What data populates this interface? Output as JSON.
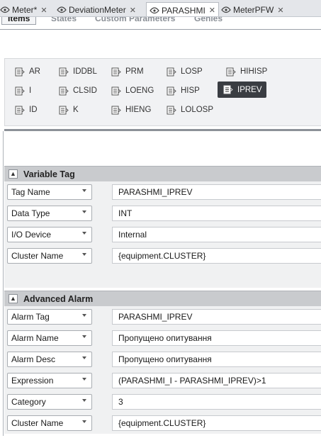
{
  "doc_tabs": [
    {
      "label": "Meter*"
    },
    {
      "label": "DeviationMeter"
    },
    {
      "label": "PARASHMI"
    },
    {
      "label": "MeterPFW"
    }
  ],
  "sub_tabs": [
    {
      "label": "Items"
    },
    {
      "label": "States"
    },
    {
      "label": "Custom Parameters"
    },
    {
      "label": "Genies"
    }
  ],
  "items": [
    {
      "label": "AR"
    },
    {
      "label": "IDDBL"
    },
    {
      "label": "PRM"
    },
    {
      "label": "LOSP"
    },
    {
      "label": "HIHISP"
    },
    {
      "label": "I"
    },
    {
      "label": "CLSID"
    },
    {
      "label": "LOENG"
    },
    {
      "label": "HISP"
    },
    {
      "label": "IPREV"
    },
    {
      "label": "ID"
    },
    {
      "label": "K"
    },
    {
      "label": "HIENG"
    },
    {
      "label": "LOLOSP"
    }
  ],
  "variable_tag": {
    "title": "Variable Tag",
    "rows": [
      {
        "property": "Tag Name",
        "value": "PARASHMI_IPREV"
      },
      {
        "property": "Data Type",
        "value": "INT"
      },
      {
        "property": "I/O Device",
        "value": "Internal"
      },
      {
        "property": "Cluster Name",
        "value": "{equipment.CLUSTER}"
      }
    ]
  },
  "advanced_alarm": {
    "title": "Advanced Alarm",
    "rows": [
      {
        "property": "Alarm Tag",
        "value": "PARASHMI_IPREV"
      },
      {
        "property": "Alarm Name",
        "value": "Пропущено опитування"
      },
      {
        "property": "Alarm Desc",
        "value": "Пропущено опитування"
      },
      {
        "property": "Expression",
        "value": "(PARASHMI_I - PARASHMI_IPREV)>1"
      },
      {
        "property": "Category",
        "value": "3"
      },
      {
        "property": "Cluster Name",
        "value": "{equipment.CLUSTER}"
      }
    ]
  },
  "icons": {
    "tab": "genie-icon",
    "item": "tag-item-icon",
    "collapse": "collapse-up-icon"
  }
}
